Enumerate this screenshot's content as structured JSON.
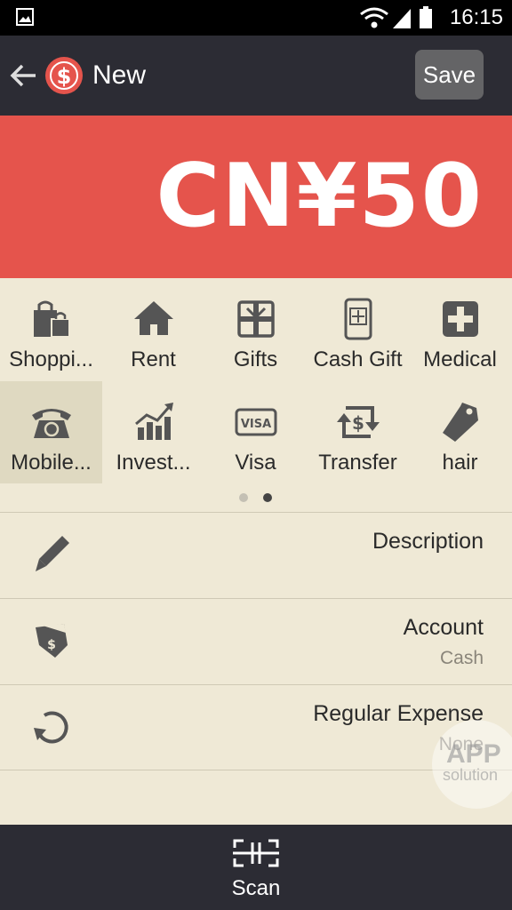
{
  "status_bar": {
    "time": "16:15"
  },
  "app_bar": {
    "title": "New",
    "save_label": "Save"
  },
  "amount": {
    "value": "CN¥50"
  },
  "categories": [
    {
      "label": "Shoppi...",
      "icon": "shopping-bags-icon"
    },
    {
      "label": "Rent",
      "icon": "house-icon"
    },
    {
      "label": "Gifts",
      "icon": "gift-box-icon"
    },
    {
      "label": "Cash Gift",
      "icon": "red-envelope-icon"
    },
    {
      "label": "Medical",
      "icon": "medical-cross-icon"
    },
    {
      "label": "Mobile...",
      "icon": "telephone-icon",
      "selected": true
    },
    {
      "label": "Invest...",
      "icon": "investment-chart-icon"
    },
    {
      "label": "Visa",
      "icon": "visa-card-icon"
    },
    {
      "label": "Transfer",
      "icon": "transfer-icon"
    },
    {
      "label": "hair",
      "icon": "tag-icon"
    }
  ],
  "pager": {
    "pages": 2,
    "current": 2
  },
  "fields": {
    "description": {
      "title": "Description"
    },
    "account": {
      "title": "Account",
      "value": "Cash"
    },
    "regular_expense": {
      "title": "Regular Expense",
      "value": "None"
    }
  },
  "bottom_bar": {
    "scan_label": "Scan"
  },
  "watermark": {
    "line1": "APP",
    "line2": "solution"
  },
  "colors": {
    "accent": "#e5544c",
    "bar": "#2c2c34",
    "background": "#efe9d6",
    "icon": "#555555"
  }
}
